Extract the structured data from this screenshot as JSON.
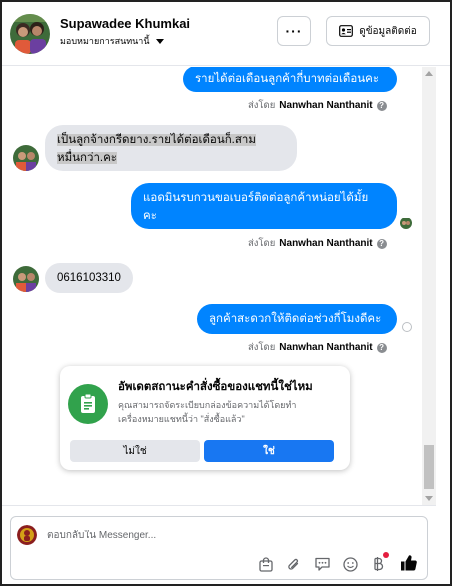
{
  "header": {
    "contact_name": "Supawadee Khumkai",
    "assign_label": "มอบหมายการสนทนานี้",
    "more_label": "···",
    "view_contact_label": "ดูข้อมูลติดต่อ"
  },
  "messages": [
    {
      "direction": "out",
      "text": "รายได้ต่อเดือนลูกค้ากี่บาทต่อเดือนคะ"
    },
    {
      "direction": "in",
      "line1": "เป็นลูกจ้างกรีดยาง.รายได้ต่อเดือนก็.สาม",
      "line2": "หมื่นกว่า.คะ"
    },
    {
      "direction": "out",
      "line1": "แอดมินรบกวนขอเบอร์ติดต่อลูกค้าหน่อยได้มั้ย",
      "line2": "คะ"
    },
    {
      "direction": "in",
      "text": "0616103310"
    },
    {
      "direction": "out",
      "text": "ลูกค้าสะดวกให้ติดต่อช่วงกี่โมงดีคะ"
    }
  ],
  "sent_by": {
    "prefix": "ส่งโดย",
    "name": "Nanwhan Nanthanit",
    "info": "?"
  },
  "card": {
    "title": "อัพเดตสถานะคำสั่งซื้อของแชทนี้ใช่ไหม",
    "body": "คุณสามารถจัดระเบียบกล่องข้อความได้โดยทำเครื่องหมายแชทนี้ว่า \"สั่งซื้อแล้ว\"",
    "no_label": "ไม่ใช่",
    "yes_label": "ใช่"
  },
  "composer": {
    "placeholder": "ตอบกลับใน Messenger..."
  },
  "icons": [
    "more-icon",
    "contact-card-icon",
    "shopping-bag-icon",
    "attachment-icon",
    "saved-reply-icon",
    "emoji-icon",
    "baht-icon",
    "like-icon",
    "order-icon"
  ],
  "colors": {
    "outgoing_bubble": "#0084ff",
    "incoming_bubble": "#e4e6eb",
    "primary_button": "#1877f2",
    "card_icon": "#31a24c"
  }
}
